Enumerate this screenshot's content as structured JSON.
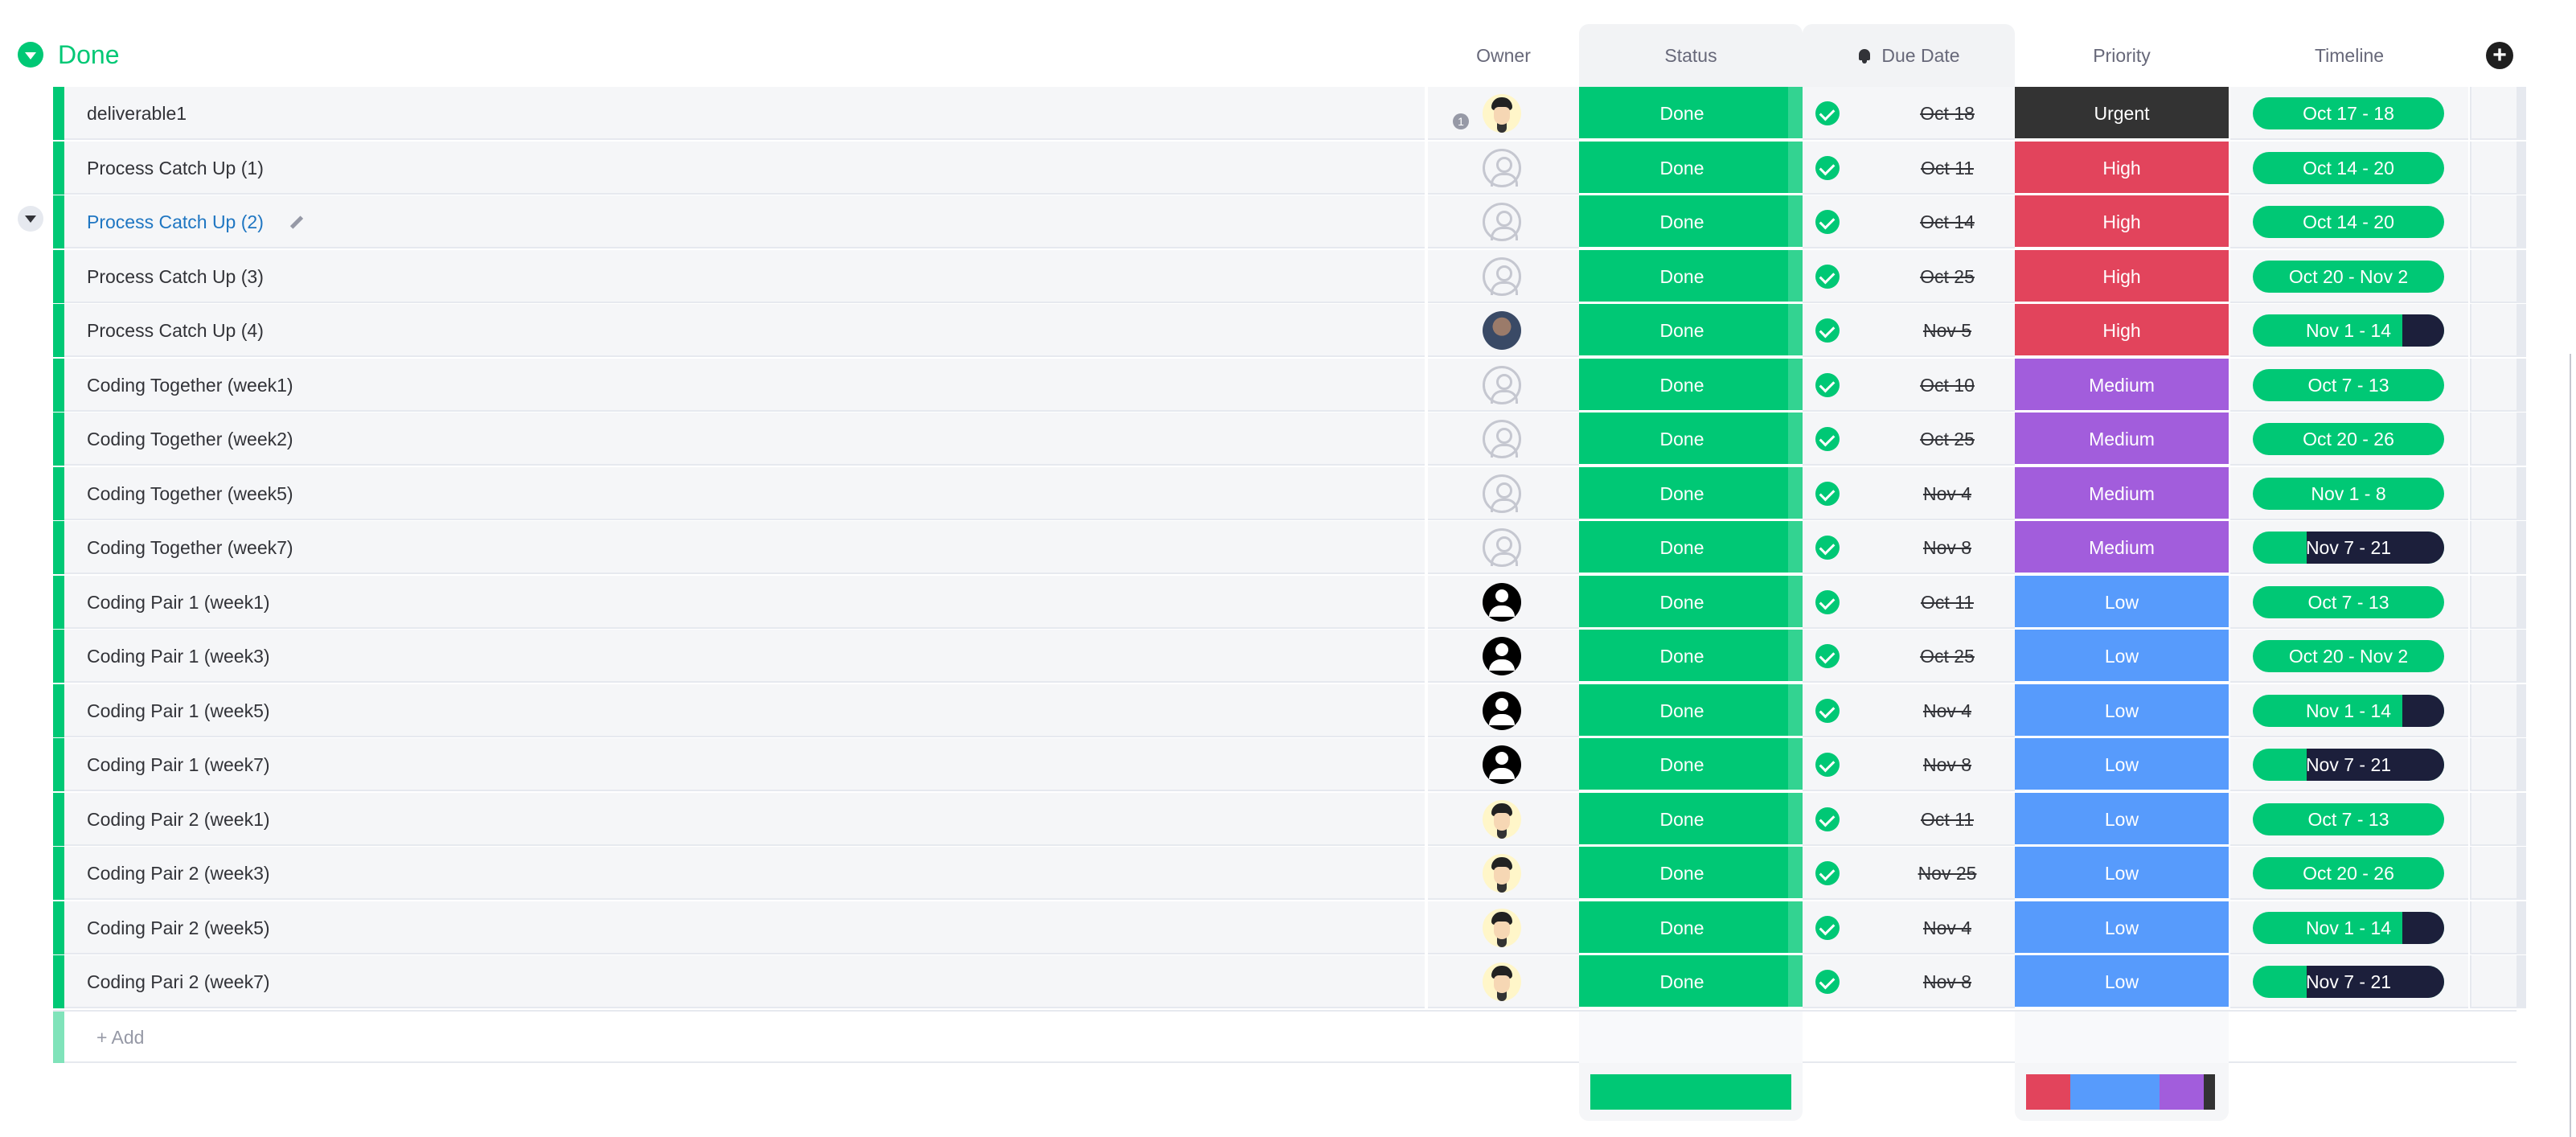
{
  "group": {
    "title": "Done",
    "color": "#00c875"
  },
  "columns": {
    "owner": "Owner",
    "status": "Status",
    "due": "Due Date",
    "priority": "Priority",
    "timeline": "Timeline"
  },
  "colors": {
    "done": "#00c875",
    "urgent": "#333333",
    "high": "#e2445c",
    "medium": "#a25ddc",
    "low": "#579bfc",
    "timeline_dark": "#1c1f3b"
  },
  "rows": [
    {
      "name": "deliverable1",
      "comments": "1",
      "owner": "cartoon",
      "status": "Done",
      "due": "Oct 18",
      "priority": "Urgent",
      "timeline": "Oct 17 - 18",
      "timeline_elapsed": 0
    },
    {
      "name": "Process Catch Up (1)",
      "comments": "",
      "owner": "empty",
      "status": "Done",
      "due": "Oct 11",
      "priority": "High",
      "timeline": "Oct 14 - 20",
      "timeline_elapsed": 0
    },
    {
      "name": "Process Catch Up (2)",
      "comments": "",
      "owner": "empty",
      "status": "Done",
      "due": "Oct 14",
      "priority": "High",
      "timeline": "Oct 14 - 20",
      "timeline_elapsed": 0,
      "highlight": true
    },
    {
      "name": "Process Catch Up (3)",
      "comments": "",
      "owner": "empty",
      "status": "Done",
      "due": "Oct 25",
      "priority": "High",
      "timeline": "Oct 20 - Nov 2",
      "timeline_elapsed": 0
    },
    {
      "name": "Process Catch Up (4)",
      "comments": "",
      "owner": "photo",
      "status": "Done",
      "due": "Nov 5",
      "priority": "High",
      "timeline": "Nov 1 - 14",
      "timeline_elapsed": 0.22
    },
    {
      "name": "Coding Together (week1)",
      "comments": "",
      "owner": "empty",
      "status": "Done",
      "due": "Oct 10",
      "priority": "Medium",
      "timeline": "Oct 7 - 13",
      "timeline_elapsed": 0
    },
    {
      "name": "Coding Together (week2)",
      "comments": "",
      "owner": "empty",
      "status": "Done",
      "due": "Oct 25",
      "priority": "Medium",
      "timeline": "Oct 20 - 26",
      "timeline_elapsed": 0
    },
    {
      "name": "Coding Together (week5)",
      "comments": "",
      "owner": "empty",
      "status": "Done",
      "due": "Nov 4",
      "priority": "Medium",
      "timeline": "Nov 1 - 8",
      "timeline_elapsed": 0
    },
    {
      "name": "Coding Together (week7)",
      "comments": "",
      "owner": "empty",
      "status": "Done",
      "due": "Nov 8",
      "priority": "Medium",
      "timeline": "Nov 7 - 21",
      "timeline_elapsed": 0.72
    },
    {
      "name": "Coding Pair 1 (week1)",
      "comments": "",
      "owner": "anon",
      "status": "Done",
      "due": "Oct 11",
      "priority": "Low",
      "timeline": "Oct 7 - 13",
      "timeline_elapsed": 0
    },
    {
      "name": "Coding Pair 1 (week3)",
      "comments": "",
      "owner": "anon",
      "status": "Done",
      "due": "Oct 25",
      "priority": "Low",
      "timeline": "Oct 20 - Nov 2",
      "timeline_elapsed": 0
    },
    {
      "name": "Coding Pair 1 (week5)",
      "comments": "",
      "owner": "anon",
      "status": "Done",
      "due": "Nov 4",
      "priority": "Low",
      "timeline": "Nov 1 - 14",
      "timeline_elapsed": 0.22
    },
    {
      "name": "Coding Pair 1 (week7)",
      "comments": "",
      "owner": "anon",
      "status": "Done",
      "due": "Nov 8",
      "priority": "Low",
      "timeline": "Nov 7 - 21",
      "timeline_elapsed": 0.72
    },
    {
      "name": "Coding Pair 2 (week1)",
      "comments": "",
      "owner": "cartoon",
      "status": "Done",
      "due": "Oct 11",
      "priority": "Low",
      "timeline": "Oct 7 - 13",
      "timeline_elapsed": 0
    },
    {
      "name": "Coding Pair 2 (week3)",
      "comments": "",
      "owner": "cartoon",
      "status": "Done",
      "due": "Nov 25",
      "priority": "Low",
      "timeline": "Oct 20 - 26",
      "timeline_elapsed": 0
    },
    {
      "name": "Coding Pair 2 (week5)",
      "comments": "",
      "owner": "cartoon",
      "status": "Done",
      "due": "Nov 4",
      "priority": "Low",
      "timeline": "Nov 1 - 14",
      "timeline_elapsed": 0.22
    },
    {
      "name": "Coding Pari 2 (week7)",
      "comments": "",
      "owner": "cartoon",
      "status": "Done",
      "due": "Nov 8",
      "priority": "Low",
      "timeline": "Nov 7 - 21",
      "timeline_elapsed": 0.72
    }
  ],
  "add_row": {
    "label": "+ Add"
  },
  "summary": {
    "status": [
      {
        "color": "#00c875",
        "fraction": 1.0
      }
    ],
    "priority": [
      {
        "color": "#e2445c",
        "fraction": 0.235
      },
      {
        "color": "#579bfc",
        "fraction": 0.47
      },
      {
        "color": "#a25ddc",
        "fraction": 0.235
      },
      {
        "color": "#333333",
        "fraction": 0.06
      }
    ]
  }
}
